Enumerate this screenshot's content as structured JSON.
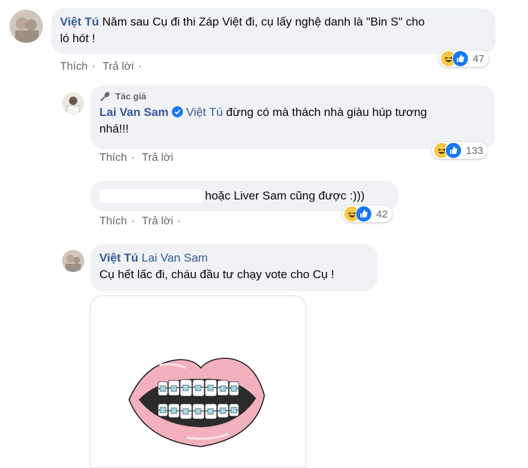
{
  "comments": [
    {
      "author": "Việt Tú",
      "text_line1": "Năm sau Cụ đi thi Záp Việt đi, cụ lấy nghệ danh là \"Bin S\" cho",
      "text_line2": "ló hót !",
      "like_label": "Thích",
      "reply_label": "Trả lời",
      "reaction_count": "47"
    }
  ],
  "reply1": {
    "author_badge": "Tác giả",
    "author": "Lai Van Sam",
    "tag": "Việt Tú",
    "text_line1": "đừng có mà thách nhà giàu húp tương",
    "text_line2": "nhá!!!",
    "like_label": "Thích",
    "reply_label": "Trả lời",
    "reaction_count": "133"
  },
  "reply2": {
    "text": "hoặc Liver Sam cũng được :)))",
    "like_label": "Thích",
    "reply_label": "Trả lời",
    "reaction_count": "42"
  },
  "reply3": {
    "author": "Việt Tú",
    "tag": "Lai Van Sam",
    "text": "Cụ hết lấc đi, cháu đầu tư chạy vote cho Cụ !"
  },
  "separator": "·",
  "colors": {
    "name": "#385898",
    "bubble": "#f0f2f5",
    "muted": "#65676b",
    "like": "#1877f2",
    "haha": "#f7c948"
  },
  "icons": [
    "haha-emoji-icon",
    "like-reaction-icon",
    "verified-badge-icon",
    "microphone-icon"
  ]
}
